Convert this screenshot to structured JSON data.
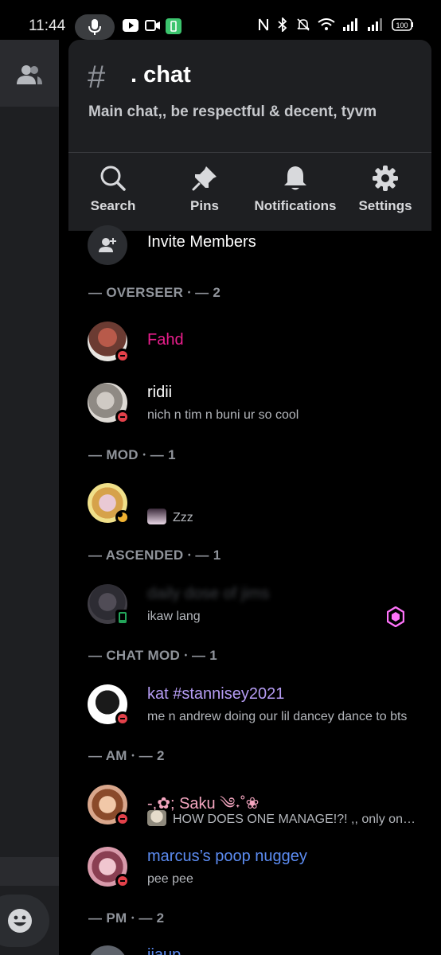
{
  "status_bar": {
    "time": "11:44",
    "battery": "100"
  },
  "channel": {
    "name": ". chat",
    "topic": "Main chat,, be respectful & decent, tyvm"
  },
  "actions": [
    {
      "label": "Search",
      "icon": "search-icon"
    },
    {
      "label": "Pins",
      "icon": "pin-icon"
    },
    {
      "label": "Notifications",
      "icon": "bell-icon"
    },
    {
      "label": "Settings",
      "icon": "gear-icon"
    }
  ],
  "invite_label": "Invite Members",
  "sections": {
    "overseer": "— OVERSEER ⸱ — 2",
    "mod": "— MOD ⸱ — 1",
    "ascended": "— ASCENDED ⸱ — 1",
    "chat_mod": "— CHAT MOD ⸱ — 1",
    "am": "— AM ⸱ — 2",
    "pm": "— PM ⸱ — 2"
  },
  "members": {
    "fahd": {
      "name": "Fahd",
      "color": "#e91e8c"
    },
    "ridii": {
      "name": "ridii",
      "status": "nich n tim n buni ur so cool",
      "color": "#ffffff"
    },
    "mod1": {
      "name": "",
      "status": "Zzz"
    },
    "ascended1": {
      "name": "daily dose of jims",
      "status": "ikaw lang"
    },
    "kat": {
      "name": "kat #stannisey2021",
      "status": "me n andrew doing our lil dancey dance to bts",
      "color": "#b59cf3"
    },
    "saku": {
      "name": "-,✿; Saku ༄˖˚❀",
      "status": "HOW DOES ONE MANAGE!?! ,, only one way",
      "color": "#f4a6c0"
    },
    "marcus": {
      "name": "marcus’s poop nuggey",
      "status": "pee pee",
      "color": "#5c8cf2"
    },
    "pm1": {
      "name": "jiaup"
    }
  },
  "colors": {
    "drawer_bg": "#000000",
    "header_bg": "#1e1f22",
    "muted": "#90949b"
  }
}
